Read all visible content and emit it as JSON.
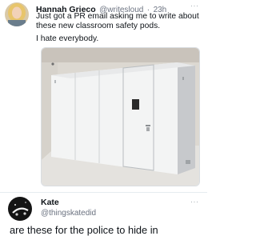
{
  "tweet": {
    "display_name": "Hannah Grieco",
    "handle": "@writesloud",
    "separator": "·",
    "time": "23h",
    "text_line1": "Just got a PR email asking me to write about",
    "text_line2": "these new classroom safety pods.",
    "text_line3": "I hate everybody.",
    "more_glyph": "···"
  },
  "reply": {
    "display_name": "Kate",
    "handle": "@thingskatedid",
    "text": "are these for the police to hide in",
    "more_glyph": "···"
  },
  "colors": {
    "text_primary": "#0f1419",
    "text_secondary": "#6b7280",
    "divider": "#e6ecf0"
  }
}
